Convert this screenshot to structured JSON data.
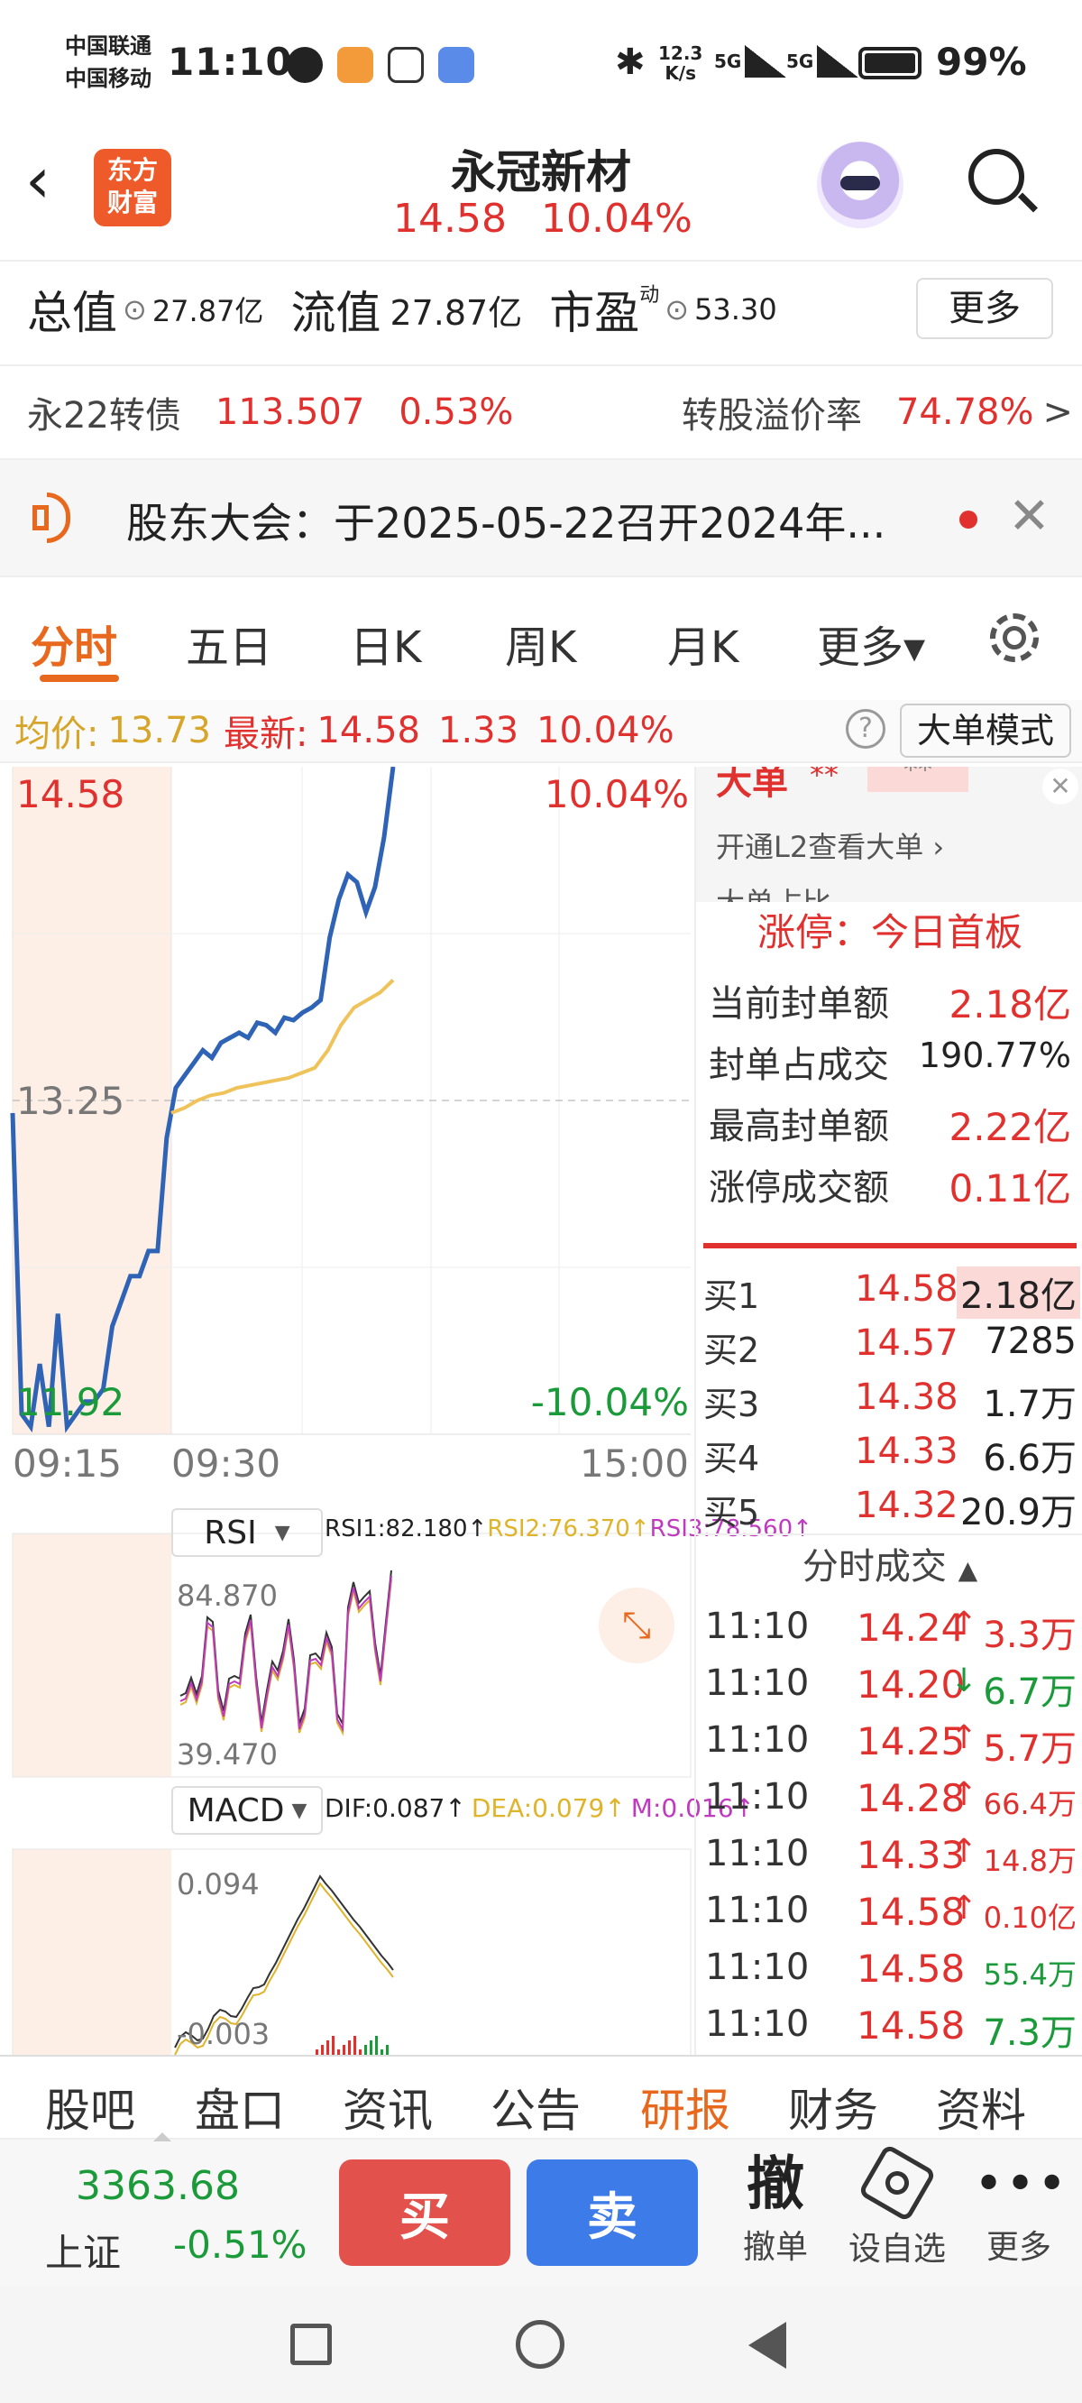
{
  "status_bar": {
    "carrier1": "中国联通",
    "carrier2": "中国移动",
    "time": "11:10",
    "speed_top": "12.3",
    "speed_bottom": "K/s",
    "net1": "5G",
    "net2": "5G",
    "battery": "99%"
  },
  "header": {
    "logo_line1": "东方",
    "logo_line2": "财富",
    "title": "永冠新材",
    "price": "14.58",
    "change_pct": "10.04%"
  },
  "stats": {
    "total_label": "总值",
    "total_value": "27.87亿",
    "float_label": "流值",
    "float_value": "27.87亿",
    "pe_label": "市盈",
    "pe_sup": "动",
    "pe_value": "53.30",
    "more_button": "更多"
  },
  "bond": {
    "label": "永22转债",
    "price": "113.507",
    "change": "0.53%",
    "premium_label": "转股溢价率",
    "premium_value": "74.78%",
    "arrow": ">"
  },
  "notice": {
    "text": "股东大会：于2025-05-22召开2024年..."
  },
  "tabs": {
    "items": [
      "分时",
      "五日",
      "日K",
      "周K",
      "月K",
      "更多▾"
    ],
    "active_index": 0
  },
  "info_bar": {
    "avg_label": "均价:",
    "avg_value": "13.73",
    "latest_label": "最新:",
    "latest_value": "14.58",
    "change": "1.33",
    "change_pct": "10.04%",
    "mode_button": "大单模式"
  },
  "chart_data": {
    "type": "line",
    "time_labels": [
      "09:15",
      "09:30",
      "15:00"
    ],
    "price_top": "14.58",
    "price_mid": "13.25",
    "price_bottom": "11.92",
    "pct_top": "10.04%",
    "pct_bottom": "-10.04%",
    "ylim": [
      11.92,
      14.58
    ],
    "series": [
      {
        "color": "#2f63b5",
        "values": [
          13.2,
          12.0,
          11.95,
          12.2,
          11.95,
          12.4,
          11.95,
          12.0,
          12.05,
          12.05,
          12.1,
          12.35,
          12.45,
          12.55,
          12.55,
          12.65,
          12.65,
          13.1,
          13.3,
          13.35,
          13.4,
          13.45,
          13.42,
          13.48,
          13.5,
          13.52,
          13.5,
          13.56,
          13.55,
          13.52,
          13.58,
          13.57,
          13.6,
          13.62,
          13.65,
          13.9,
          14.05,
          14.15,
          14.12,
          14.0,
          14.1,
          14.3,
          14.58
        ]
      },
      {
        "color": "#f0c35a",
        "values": [
          13.2,
          13.22,
          13.25,
          13.27,
          13.28,
          13.3,
          13.31,
          13.32,
          13.33,
          13.34,
          13.36,
          13.38,
          13.45,
          13.55,
          13.62,
          13.65,
          13.68,
          13.73
        ]
      }
    ]
  },
  "rsi": {
    "label": "RSI",
    "rsi1": "RSI1:82.180↑",
    "rsi2": "RSI2:76.370↑",
    "rsi3": "RSI3:78.560↑",
    "top": "84.870",
    "bottom": "39.470"
  },
  "macd": {
    "label": "MACD",
    "dif": "DIF:0.087↑",
    "dea": "DEA:0.079↑",
    "m": "M:0.016↑",
    "top": "0.094",
    "bottom": "-0.003"
  },
  "big_order": {
    "title": "大单",
    "masked1": "**",
    "masked2": "**",
    "link": "开通L2查看大单 ›",
    "partial": "大单占比"
  },
  "limit_up": {
    "title": "涨停：今日首板",
    "rows": [
      {
        "label": "当前封单额",
        "value": "2.18亿",
        "red": true
      },
      {
        "label": "封单占成交",
        "value": "190.77%",
        "red": false
      },
      {
        "label": "最高封单额",
        "value": "2.22亿",
        "red": true
      },
      {
        "label": "涨停成交额",
        "value": "0.11亿",
        "red": true
      }
    ]
  },
  "order_book": [
    {
      "label": "买1",
      "price": "14.58",
      "vol": "2.18亿"
    },
    {
      "label": "买2",
      "price": "14.57",
      "vol": "7285"
    },
    {
      "label": "买3",
      "price": "14.38",
      "vol": "1.7万"
    },
    {
      "label": "买4",
      "price": "14.33",
      "vol": "6.6万"
    },
    {
      "label": "买5",
      "price": "14.32",
      "vol": "20.9万"
    }
  ],
  "trades": {
    "title": "分时成交",
    "rows": [
      {
        "time": "11:10",
        "price": "14.24",
        "arrow": "↑",
        "vol": "3.3万",
        "dir": "up"
      },
      {
        "time": "11:10",
        "price": "14.20",
        "arrow": "↓",
        "vol": "6.7万",
        "dir": "down"
      },
      {
        "time": "11:10",
        "price": "14.25",
        "arrow": "↑",
        "vol": "5.7万",
        "dir": "up"
      },
      {
        "time": "11:10",
        "price": "14.28",
        "arrow": "↑",
        "vol": "66.4万",
        "dir": "up"
      },
      {
        "time": "11:10",
        "price": "14.33",
        "arrow": "↑",
        "vol": "14.8万",
        "dir": "up"
      },
      {
        "time": "11:10",
        "price": "14.58",
        "arrow": "↑",
        "vol": "0.10亿",
        "dir": "up"
      },
      {
        "time": "11:10",
        "price": "14.58",
        "arrow": "",
        "vol": "55.4万",
        "dir": "flat"
      },
      {
        "time": "11:10",
        "price": "14.58",
        "arrow": "",
        "vol": "7.3万",
        "dir": "flat"
      }
    ]
  },
  "bottom_tabs": {
    "items": [
      "股吧",
      "盘口",
      "资讯",
      "公告",
      "研报",
      "财务",
      "资料"
    ],
    "active_index": 4
  },
  "footer": {
    "index_value": "3363.68",
    "index_name": "上证",
    "index_change": "-0.51%",
    "buy": "买",
    "sell": "卖",
    "cancel_glyph": "撤",
    "cancel_label": "撤单",
    "watch_label": "设自选",
    "more_label": "更多"
  }
}
